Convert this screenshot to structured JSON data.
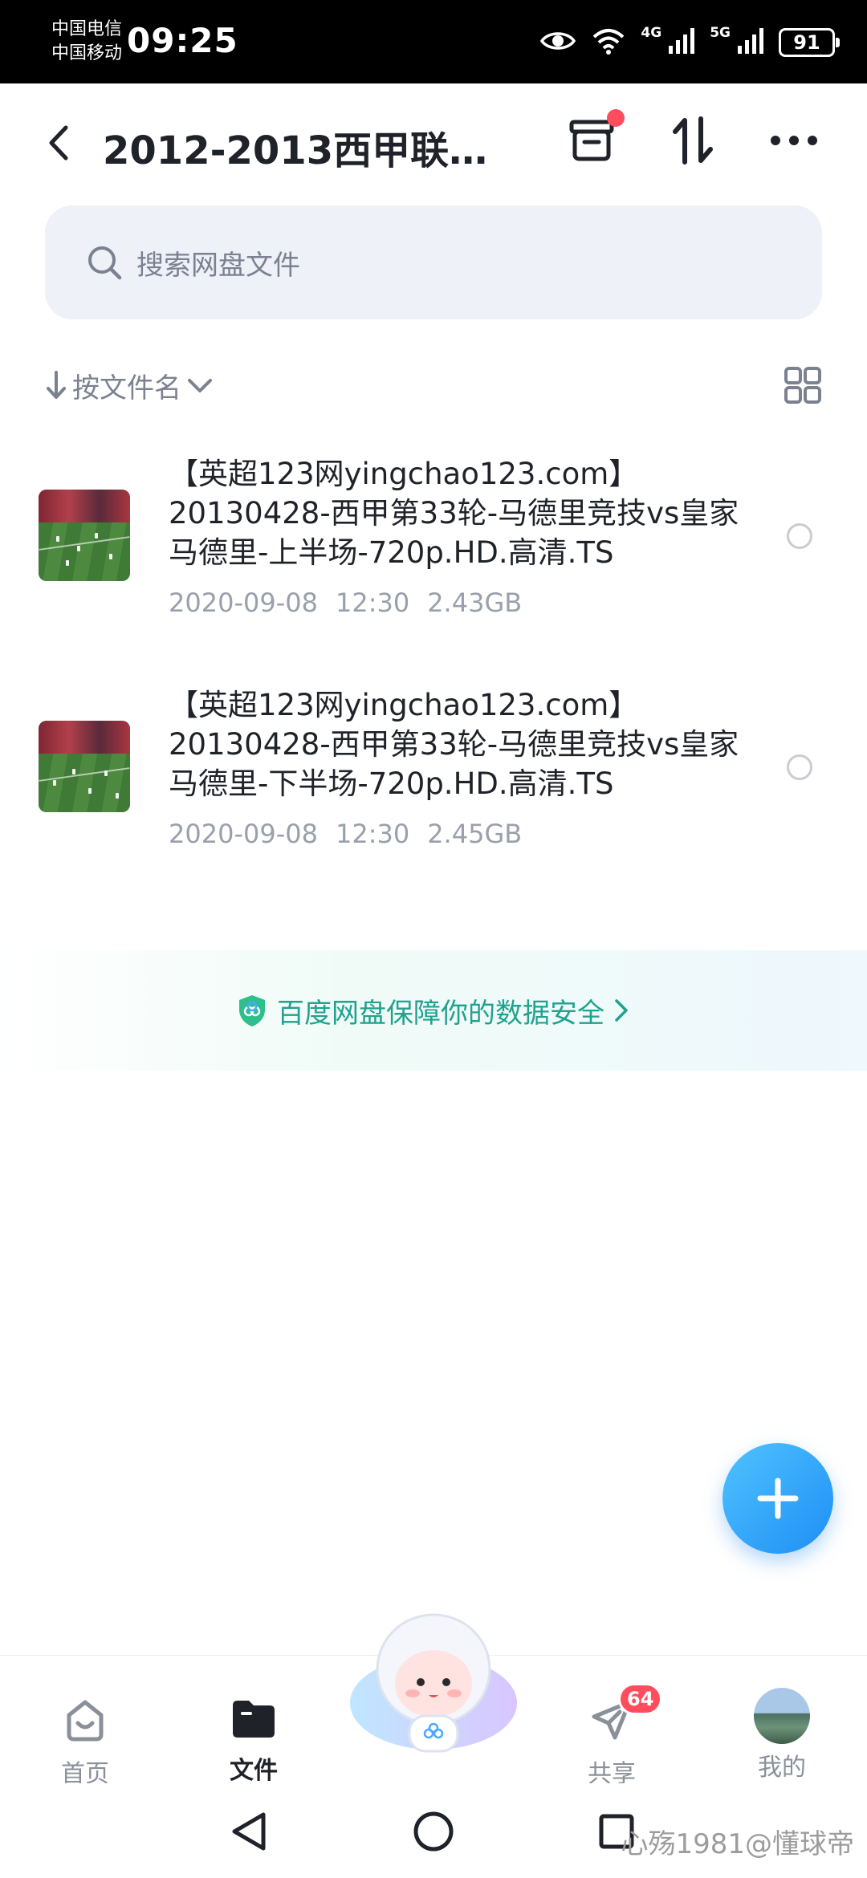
{
  "status_bar": {
    "carrier_1": "中国电信",
    "carrier_2": "中国移动",
    "time": "09:25",
    "network_1": "4G",
    "network_2": "5G",
    "battery": "91"
  },
  "header": {
    "title": "2012-2013西甲联…",
    "icons": [
      "back-icon",
      "transfer-list-icon",
      "sort-transfer-icon",
      "more-icon"
    ]
  },
  "search": {
    "placeholder": "搜索网盘文件"
  },
  "sort": {
    "label": "按文件名"
  },
  "files": [
    {
      "name": "【英超123网yingchao123.com】20130428-西甲第33轮-马德里竞技vs皇家马德里-上半场-720p.HD.高清.TS",
      "date": "2020-09-08",
      "time": "12:30",
      "size": "2.43GB"
    },
    {
      "name": "【英超123网yingchao123.com】20130428-西甲第33轮-马德里竞技vs皇家马德里-下半场-720p.HD.高清.TS",
      "date": "2020-09-08",
      "time": "12:30",
      "size": "2.45GB"
    }
  ],
  "security_banner": {
    "text": "百度网盘保障你的数据安全"
  },
  "tabs": [
    {
      "label": "首页",
      "icon": "home-icon"
    },
    {
      "label": "文件",
      "icon": "folder-icon",
      "active": true
    },
    {
      "label": "共享",
      "icon": "share-icon",
      "badge": "64"
    },
    {
      "label": "我的",
      "icon": "avatar"
    }
  ],
  "watermark": "心殇1981@懂球帝",
  "colors": {
    "accent": "#1f8ef5",
    "badge": "#ff4d5e",
    "security_green": "#1fa28e"
  }
}
